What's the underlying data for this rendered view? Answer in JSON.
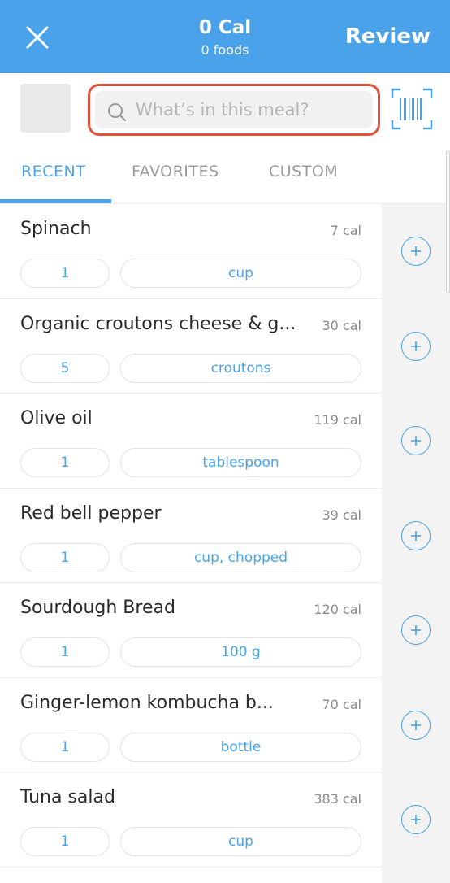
{
  "header": {
    "calories": "0 Cal",
    "foods_count": "0 foods",
    "review_label": "Review"
  },
  "search": {
    "placeholder": "What’s in this meal?"
  },
  "tabs": [
    {
      "label": "RECENT",
      "active": true
    },
    {
      "label": "FAVORITES",
      "active": false
    },
    {
      "label": "CUSTOM",
      "active": false
    }
  ],
  "foods": [
    {
      "name": "Spinach",
      "calories": "7 cal",
      "quantity": "1",
      "unit": "cup"
    },
    {
      "name": "Organic croutons cheese & g...",
      "calories": "30 cal",
      "quantity": "5",
      "unit": "croutons"
    },
    {
      "name": "Olive oil",
      "calories": "119 cal",
      "quantity": "1",
      "unit": "tablespoon"
    },
    {
      "name": "Red bell pepper",
      "calories": "39 cal",
      "quantity": "1",
      "unit": "cup, chopped"
    },
    {
      "name": "Sourdough Bread",
      "calories": "120 cal",
      "quantity": "1",
      "unit": "100 g"
    },
    {
      "name": "Ginger-lemon kombucha b...",
      "calories": "70 cal",
      "quantity": "1",
      "unit": "bottle"
    },
    {
      "name": "Tuna salad",
      "calories": "383 cal",
      "quantity": "1",
      "unit": "cup"
    }
  ],
  "icons": {
    "close": "close-icon",
    "search": "search-icon",
    "barcode": "barcode-scan-icon",
    "add": "plus-circle-icon"
  },
  "colors": {
    "accent": "#4aa3ea",
    "highlight_outline": "#e8503a"
  }
}
